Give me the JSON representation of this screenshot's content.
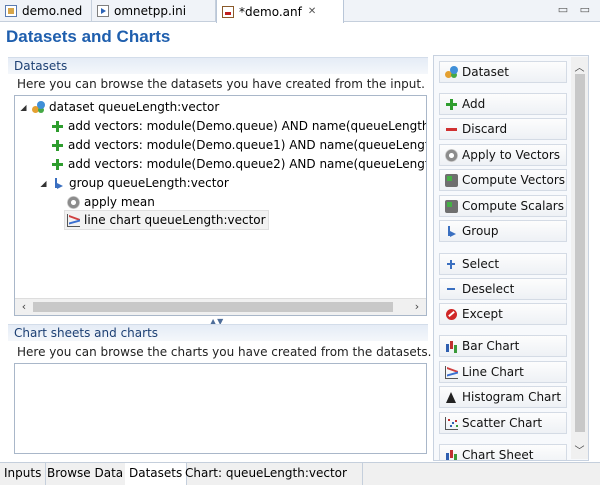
{
  "editor_tabs": [
    {
      "label": "demo.ned",
      "icon": "ned-file-icon"
    },
    {
      "label": "omnetpp.ini",
      "icon": "ini-file-icon"
    },
    {
      "label": "*demo.anf",
      "icon": "anf-file-icon",
      "close": "✕"
    }
  ],
  "window_controls": "▭ ▭",
  "page_title": "Datasets and Charts",
  "datasets_section": {
    "title": "Datasets",
    "description": "Here you can browse the datasets you have created from the input.",
    "tree": [
      {
        "label": "dataset queueLength:vector",
        "icon": "dataset-icon",
        "expanded": true
      },
      {
        "label": "add vectors: module(Demo.queue) AND name(queueLength",
        "icon": "add-icon"
      },
      {
        "label": "add vectors: module(Demo.queue1) AND name(queueLengt",
        "icon": "add-icon"
      },
      {
        "label": "add vectors: module(Demo.queue2) AND name(queueLengt",
        "icon": "add-icon"
      },
      {
        "label": "group queueLength:vector",
        "icon": "group-icon",
        "expanded": true
      },
      {
        "label": "apply mean",
        "icon": "apply-gear-icon"
      },
      {
        "label": "line chart queueLength:vector",
        "icon": "line-chart-icon",
        "selected": true
      }
    ]
  },
  "charts_section": {
    "title": "Chart sheets and charts",
    "description": "Here you can browse the charts you have created from the datasets."
  },
  "buttons": [
    {
      "label": "Dataset",
      "icon": "dataset-icon"
    },
    {
      "label": "Add",
      "icon": "add-icon"
    },
    {
      "label": "Discard",
      "icon": "discard-icon"
    },
    {
      "label": "Apply to Vectors",
      "icon": "apply-gear-icon"
    },
    {
      "label": "Compute Vectors",
      "icon": "compute-vectors-icon"
    },
    {
      "label": "Compute Scalars",
      "icon": "compute-scalars-icon"
    },
    {
      "label": "Group",
      "icon": "group-icon"
    },
    {
      "label": "Select",
      "icon": "select-icon"
    },
    {
      "label": "Deselect",
      "icon": "deselect-icon"
    },
    {
      "label": "Except",
      "icon": "except-icon"
    },
    {
      "label": "Bar Chart",
      "icon": "bar-chart-icon"
    },
    {
      "label": "Line Chart",
      "icon": "line-chart-icon"
    },
    {
      "label": "Histogram Chart",
      "icon": "histogram-chart-icon"
    },
    {
      "label": "Scatter Chart",
      "icon": "scatter-chart-icon"
    },
    {
      "label": "Chart Sheet",
      "icon": "chart-sheet-icon"
    }
  ],
  "page_tabs": [
    {
      "label": "Inputs",
      "active": false
    },
    {
      "label": "Browse Data",
      "active": false
    },
    {
      "label": "Datasets",
      "active": true
    },
    {
      "label": "Chart: queueLength:vector",
      "active": false
    }
  ]
}
